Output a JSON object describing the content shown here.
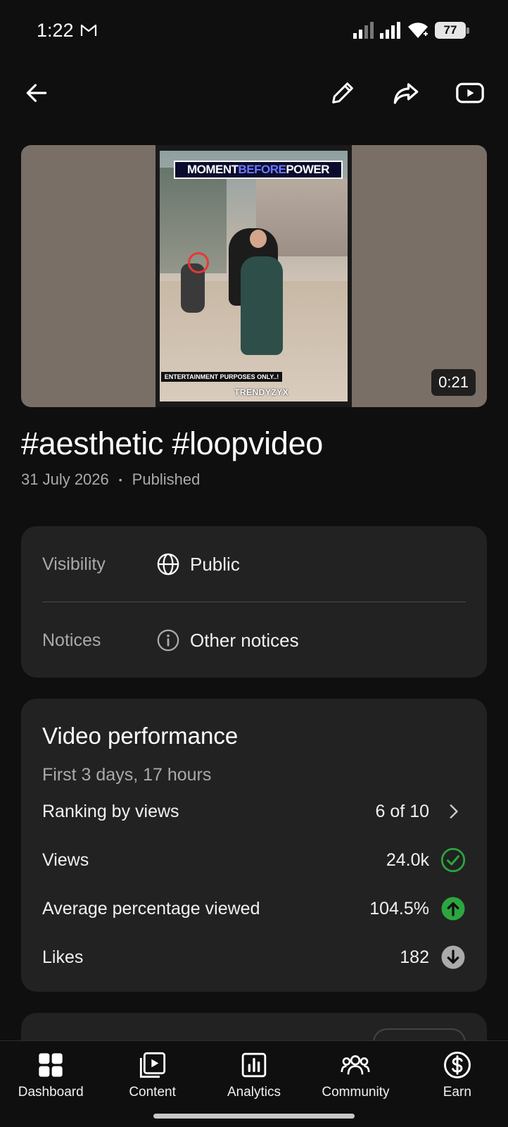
{
  "status_bar": {
    "time": "1:22",
    "battery": "77",
    "icons": [
      "gmail-icon",
      "signal-icon",
      "signal-icon",
      "wifi-icon",
      "battery-icon"
    ]
  },
  "top_bar": {
    "icons": [
      "back-arrow-icon",
      "edit-pencil-icon",
      "share-icon",
      "youtube-icon"
    ]
  },
  "video": {
    "thumbnail_text_top": [
      "MOMENT ",
      "BEFORE",
      " POWER"
    ],
    "thumbnail_text_bottom": "ENTERTAINMENT PURPOSES ONLY..!",
    "thumbnail_watermark": "TRENDYZYX",
    "duration": "0:21",
    "title": "#aesthetic #loopvideo",
    "date": "31 July 2026",
    "separator": "•",
    "status": "Published"
  },
  "details": {
    "visibility_label": "Visibility",
    "visibility_value": "Public",
    "notices_label": "Notices",
    "notices_value": "Other notices"
  },
  "performance": {
    "title": "Video performance",
    "subtitle": "First 3 days, 17 hours",
    "rows": [
      {
        "label": "Ranking by views",
        "value": "6 of 10",
        "icon": "chevron-right-icon"
      },
      {
        "label": "Views",
        "value": "24.0k",
        "icon": "check-circle-icon"
      },
      {
        "label": "Average percentage viewed",
        "value": "104.5%",
        "icon": "arrow-up-circle-icon"
      },
      {
        "label": "Likes",
        "value": "182",
        "icon": "arrow-down-circle-icon"
      }
    ]
  },
  "colors": {
    "background": "#0f0f0f",
    "card": "#222222",
    "success_green": "#2ba640",
    "muted_gray": "#aaaaaa"
  },
  "bottom_nav": {
    "items": [
      {
        "label": "Dashboard",
        "icon": "dashboard-icon"
      },
      {
        "label": "Content",
        "icon": "content-icon"
      },
      {
        "label": "Analytics",
        "icon": "analytics-icon"
      },
      {
        "label": "Community",
        "icon": "community-icon"
      },
      {
        "label": "Earn",
        "icon": "earn-dollar-icon"
      }
    ]
  }
}
